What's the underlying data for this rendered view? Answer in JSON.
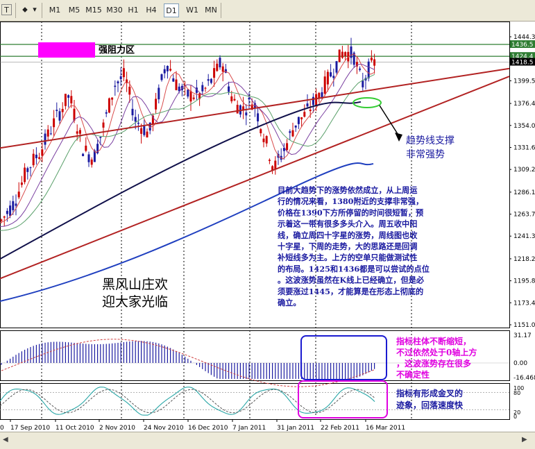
{
  "toolbar": {
    "timeframes": [
      "M1",
      "M5",
      "M15",
      "M30",
      "H1",
      "H4",
      "D1",
      "W1",
      "MN"
    ],
    "active": "D1"
  },
  "price_axis": [
    "1444.3",
    "1399.5",
    "1376.4",
    "1354.0",
    "1331.6",
    "1309.2",
    "1286.1",
    "1263.7",
    "1241.3",
    "1218.2",
    "1195.8",
    "1173.4",
    "1151.0"
  ],
  "price_tags": [
    {
      "label": "1436.5",
      "color": "#2e7d32"
    },
    {
      "label": "1424.4",
      "color": "#2e7d32"
    },
    {
      "label": "1418.5",
      "color": "#000000"
    }
  ],
  "macd_axis": [
    "31.17",
    "0.00",
    "-16.468"
  ],
  "stoch_axis": [
    "100",
    "80",
    "20",
    "0"
  ],
  "date_axis": [
    "17 Sep 2010",
    "11 Oct 2010",
    "2 Nov 2010",
    "24 Nov 2010",
    "16 Dec 2010",
    "7 Jan 2011",
    "31 Jan 2011",
    "22 Feb 2011",
    "16 Mar 2011"
  ],
  "annotations": {
    "resistance": "强阻力区",
    "trend_support": [
      "趋势线支撑",
      "非常强势"
    ],
    "main_analysis": [
      "目前大趋势下的涨势依然成立，从上周运",
      "行的情况来看，1380附近的支撑非常强，",
      "价格在1390下方所停留的时间很短暂，预",
      "示着这一带有很多多头介入。周五收中阳",
      "线，确立周四十字星的涨势，周线图也收",
      "十字星，下周的走势，大的思路还是回调",
      "补短线多为主。上方的空单只能做测试性",
      "的布局。1425和1436都是可以尝试的点位",
      "。这波涨势虽然在K线上已经确立，但是必",
      "须要涨过1445，才能算是在形态上彻底的",
      "确立。"
    ],
    "welcome": [
      "黑风山庄欢",
      "迎大家光临"
    ],
    "macd_note": [
      "指标柱体不断缩短，",
      "不过依然处于0轴上方",
      "，这波涨势存在很多",
      "不确定性"
    ],
    "stoch_note": [
      "指标有形成金叉的",
      "迹象，回落速度快"
    ]
  },
  "colors": {
    "candle_up": "#cc0000",
    "candle_down": "#1a1aa0",
    "trendline": "#b22222",
    "annotation_blue": "#1a1aa0",
    "annotation_magenta": "#e000e0",
    "resistance_box": "#ff00ff",
    "support_ellipse": "#33cc33"
  }
}
